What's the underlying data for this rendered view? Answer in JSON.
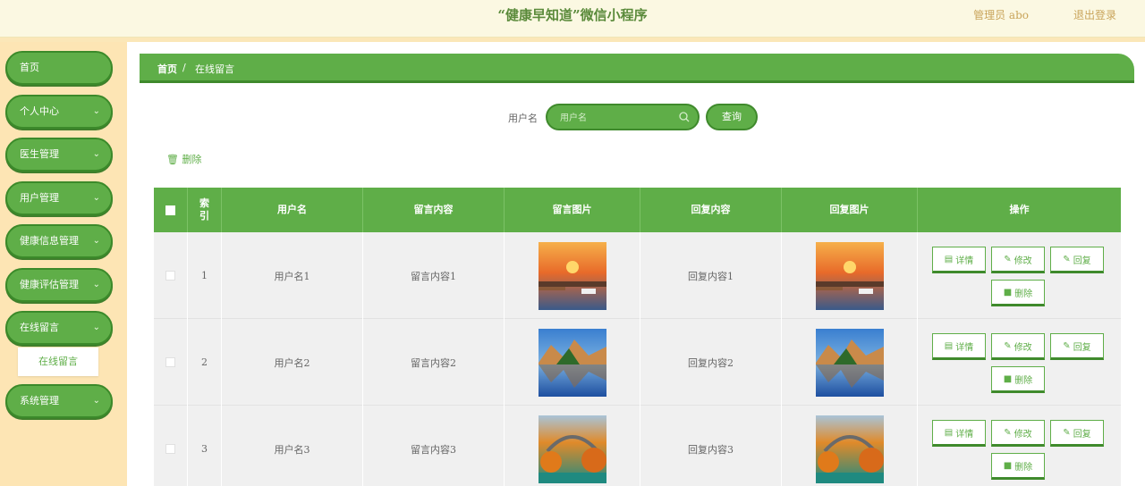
{
  "header": {
    "title": "“健康早知道”微信小程序",
    "admin": "管理员 abo",
    "logout": "退出登录"
  },
  "sidebar": {
    "items": [
      {
        "label": "首页",
        "chevron": false
      },
      {
        "label": "个人中心",
        "chevron": true
      },
      {
        "label": "医生管理",
        "chevron": true
      },
      {
        "label": "用户管理",
        "chevron": true
      },
      {
        "label": "健康信息管理",
        "chevron": true
      },
      {
        "label": "健康评估管理",
        "chevron": true
      },
      {
        "label": "在线留言",
        "chevron": true
      },
      {
        "label": "系统管理",
        "chevron": true
      }
    ],
    "sub_item": "在线留言"
  },
  "breadcrumb": {
    "home": "首页",
    "sep": "/",
    "current": "在线留言"
  },
  "search": {
    "label": "用户名",
    "placeholder": "用户名",
    "button": "查询"
  },
  "toolbar": {
    "delete": "删除"
  },
  "table": {
    "headers": [
      "索\n引",
      "用户名",
      "留言内容",
      "留言图片",
      "回复内容",
      "回复图片",
      "操作"
    ],
    "rows": [
      {
        "index": "1",
        "user": "用户名1",
        "message": "留言内容1",
        "reply": "回复内容1",
        "image": "sunset-harbor"
      },
      {
        "index": "2",
        "user": "用户名2",
        "message": "留言内容2",
        "reply": "回复内容2",
        "image": "mountain-lake"
      },
      {
        "index": "3",
        "user": "用户名3",
        "message": "留言内容3",
        "reply": "回复内容3",
        "image": "autumn-bridge"
      }
    ],
    "actions": {
      "detail": "详情",
      "edit": "修改",
      "reply": "回复",
      "delete": "删除"
    }
  },
  "colors": {
    "accent": "#5fae48",
    "accent_dark": "#3f8a2c",
    "sidebar_bg": "#fde5b4",
    "header_bg": "#fbf8e2"
  }
}
